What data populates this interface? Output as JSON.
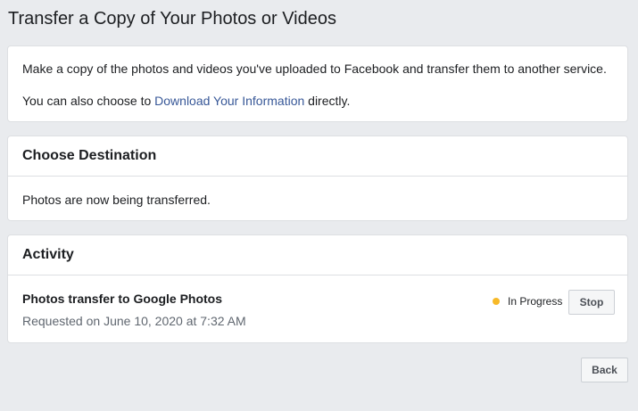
{
  "page": {
    "title": "Transfer a Copy of Your Photos or Videos"
  },
  "intro": {
    "description": "Make a copy of the photos and videos you've uploaded to Facebook and transfer them to another service.",
    "alt_prefix": "You can also choose to ",
    "alt_link": "Download Your Information",
    "alt_suffix": " directly."
  },
  "destination": {
    "heading": "Choose Destination",
    "message": "Photos are now being transferred."
  },
  "activity": {
    "heading": "Activity",
    "item": {
      "title": "Photos transfer to Google Photos",
      "requested": "Requested on June 10, 2020 at 7:32 AM",
      "status": "In Progress",
      "status_color": "#f7b928",
      "stop_label": "Stop"
    }
  },
  "footer": {
    "back_label": "Back"
  }
}
